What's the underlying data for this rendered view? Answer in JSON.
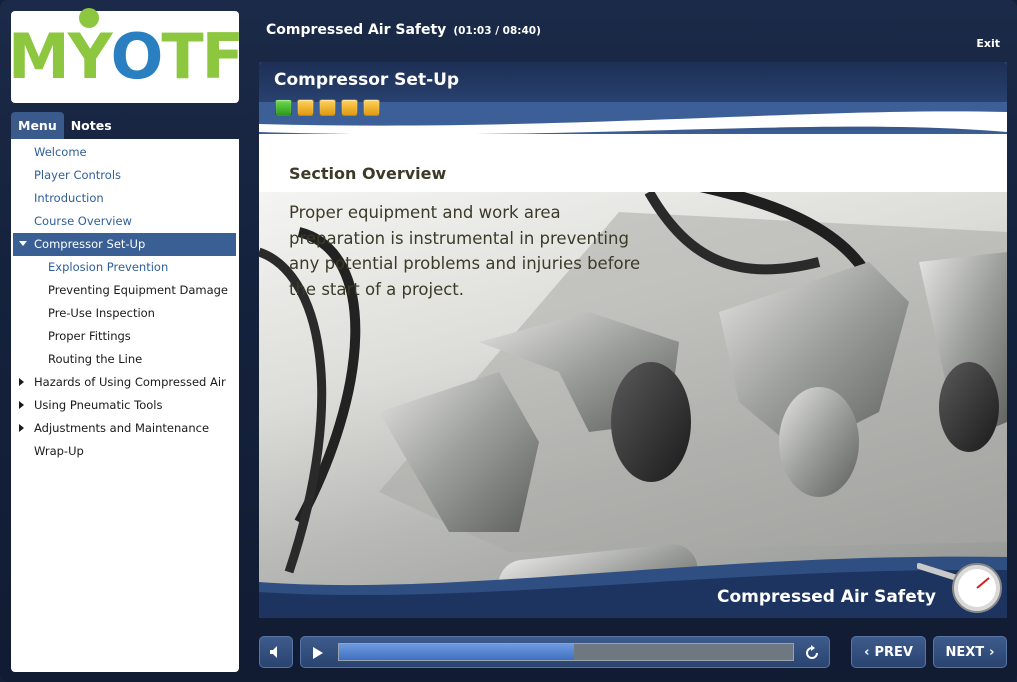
{
  "logo": {
    "text_m": "M",
    "text_y": "Y",
    "text_o": "O",
    "text_t": "T",
    "text_f": "F"
  },
  "tabs": [
    {
      "label": "Menu",
      "active": true
    },
    {
      "label": "Notes",
      "active": false
    }
  ],
  "menu": {
    "items": [
      {
        "label": "Welcome",
        "state": "visited"
      },
      {
        "label": "Player Controls",
        "state": "visited"
      },
      {
        "label": "Introduction",
        "state": "visited"
      },
      {
        "label": "Course Overview",
        "state": "visited"
      },
      {
        "label": "Compressor Set-Up",
        "state": "active",
        "expanded": true
      },
      {
        "label": "Explosion Prevention",
        "state": "current-sub"
      },
      {
        "label": "Preventing Equipment Damage",
        "state": "sub"
      },
      {
        "label": "Pre-Use Inspection",
        "state": "sub"
      },
      {
        "label": "Proper Fittings",
        "state": "sub"
      },
      {
        "label": "Routing the Line",
        "state": "sub"
      },
      {
        "label": "Hazards of Using Compressed Air",
        "state": "collapsed"
      },
      {
        "label": "Using Pneumatic Tools",
        "state": "collapsed"
      },
      {
        "label": "Adjustments and Maintenance",
        "state": "collapsed"
      },
      {
        "label": "Wrap-Up",
        "state": "plain"
      }
    ]
  },
  "header": {
    "course_title": "Compressed Air Safety",
    "time": "(01:03 / 08:40)",
    "exit_label": "Exit"
  },
  "slide": {
    "title": "Compressor Set-Up",
    "section_progress": {
      "completed": 1,
      "total": 5
    },
    "section_heading": "Section Overview",
    "body": "Proper equipment and work area preparation is instrumental in preventing any potential problems and injuries before the start of a project.",
    "footer_title": "Compressed Air Safety"
  },
  "controls": {
    "seek_progress": 0.517,
    "prev_label": "PREV",
    "next_label": "NEXT"
  },
  "colors": {
    "accent_blue": "#3a5f94",
    "link_blue": "#2f5e9a",
    "logo_green": "#8dc63f",
    "logo_blue": "#2a7fc1",
    "progress_done": "#2e9a1f",
    "progress_todo": "#e09a12"
  },
  "icons": [
    "volume-icon",
    "play-icon",
    "replay-icon",
    "chevron-left-icon",
    "chevron-right-icon",
    "pressure-gauge-icon"
  ]
}
